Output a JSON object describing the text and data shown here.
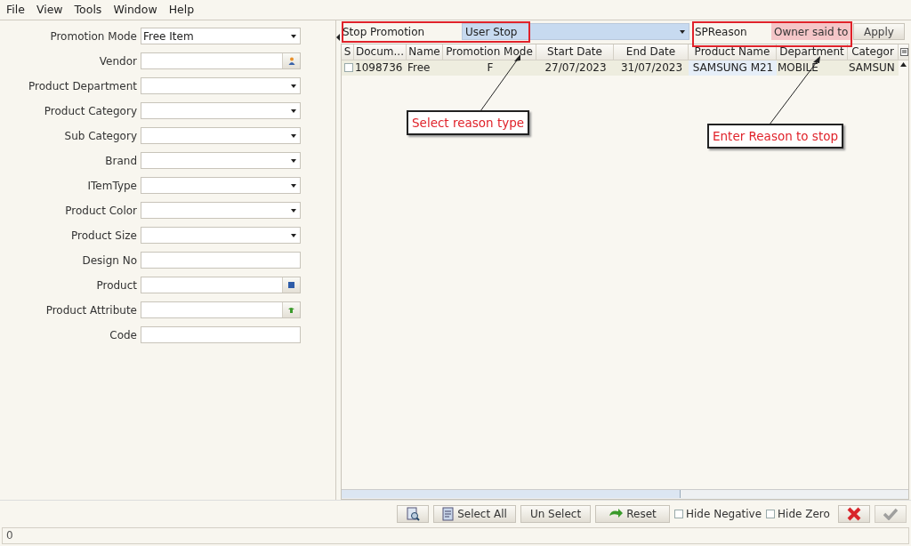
{
  "menu": [
    {
      "label": "File"
    },
    {
      "label": "View"
    },
    {
      "label": "Tools"
    },
    {
      "label": "Window"
    },
    {
      "label": "Help"
    }
  ],
  "filters": [
    {
      "label": "Promotion Mode",
      "kind": "combo",
      "value": "Free Item"
    },
    {
      "label": "Vendor",
      "kind": "lookup"
    },
    {
      "label": "Product Department",
      "kind": "combo"
    },
    {
      "label": "Product Category",
      "kind": "combo"
    },
    {
      "label": "Sub Category",
      "kind": "combo"
    },
    {
      "label": "Brand",
      "kind": "combo"
    },
    {
      "label": "ITemType",
      "kind": "combo"
    },
    {
      "label": "Product Color",
      "kind": "combo"
    },
    {
      "label": "Product Size",
      "kind": "combo"
    },
    {
      "label": "Design No",
      "kind": "text"
    },
    {
      "label": "Product",
      "kind": "lookup"
    },
    {
      "label": "Product Attribute",
      "kind": "lookup"
    },
    {
      "label": "Code",
      "kind": "text"
    }
  ],
  "stop_bar": {
    "label": "Stop Promotion",
    "reason_type": "User Stop",
    "reason_label": "SPReason",
    "reason": "Owner said to",
    "apply": "Apply"
  },
  "table": {
    "columns": [
      "S",
      "Docum...",
      "Name",
      "Promotion Mode",
      "Start Date",
      "End Date",
      "Product Name",
      "Department",
      "Categor"
    ],
    "rows": [
      {
        "checked": false,
        "cells": [
          "",
          "1098736",
          "Free",
          "F",
          "27/07/2023",
          "31/07/2023",
          "SAMSUNG M21",
          "MOBILE",
          "SAMSUN"
        ]
      }
    ]
  },
  "annotations": [
    {
      "text": "Select reason type"
    },
    {
      "text": "Enter Reason to stop"
    }
  ],
  "toolbar": {
    "select_all": {
      "label": "Select All"
    },
    "unselect": "Un Select",
    "reset": "Reset",
    "options": [
      {
        "label": "Hide Negative",
        "checked": false
      },
      {
        "label": "Hide Zero",
        "checked": false
      }
    ],
    "ok_disabled": true
  },
  "status_bar": {
    "value": "0"
  }
}
